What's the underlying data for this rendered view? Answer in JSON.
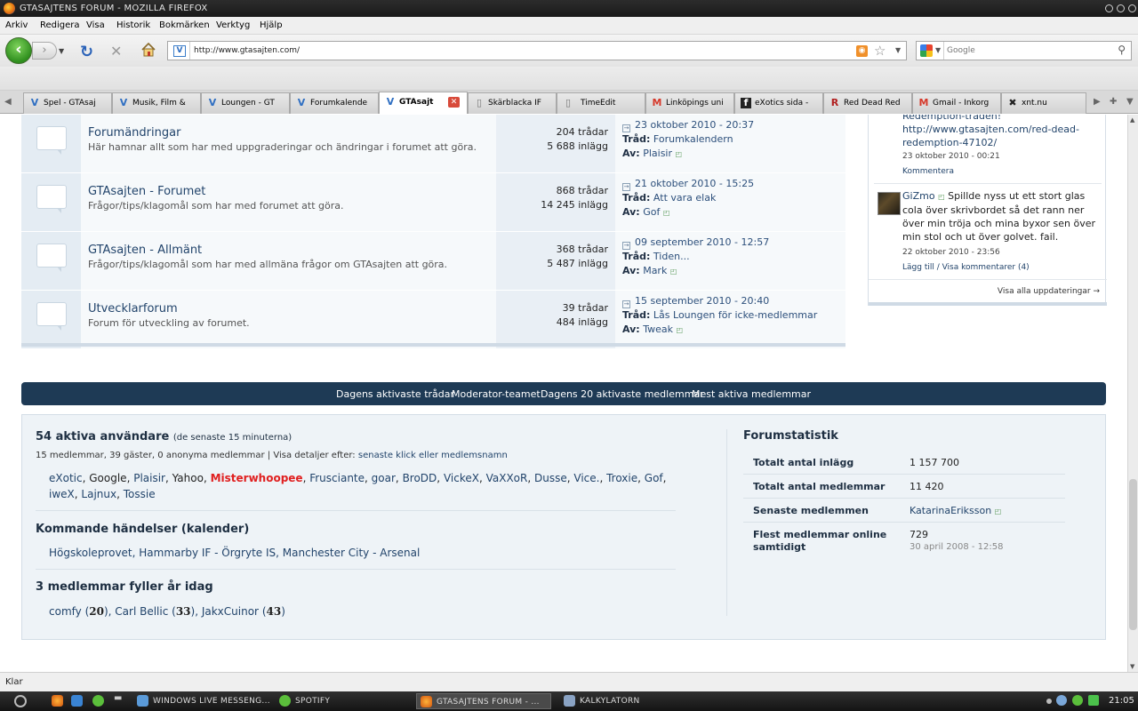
{
  "window": {
    "title": "GTASAJTENS FORUM - MOZILLA FIREFOX"
  },
  "menu": {
    "items": [
      "Arkiv",
      "Redigera",
      "Visa",
      "Historik",
      "Bokmärken",
      "Verktyg",
      "Hjälp"
    ]
  },
  "nav": {
    "url": "http://www.gtasajten.com/",
    "search_placeholder": "Google"
  },
  "tabs": [
    {
      "label": "Spel - GTAsaj",
      "icon": "gtasajten-icon"
    },
    {
      "label": "Musik, Film &",
      "icon": "gtasajten-icon"
    },
    {
      "label": "Loungen - GT",
      "icon": "gtasajten-icon"
    },
    {
      "label": "Forumkalende",
      "icon": "gtasajten-icon"
    },
    {
      "label": "GTAsajt",
      "icon": "gtasajten-icon",
      "active": true
    },
    {
      "label": "Skärblacka IF",
      "icon": "page-icon"
    },
    {
      "label": "TimeEdit",
      "icon": "page-icon"
    },
    {
      "label": "Linköpings uni",
      "icon": "gmail-icon"
    },
    {
      "label": "eXotics sida -",
      "icon": "facebook-icon"
    },
    {
      "label": "Red Dead Red",
      "icon": "rdr-icon"
    },
    {
      "label": "Gmail - Inkorg",
      "icon": "gmail-icon"
    },
    {
      "label": "xnt.nu",
      "icon": "xnt-icon"
    }
  ],
  "forums": [
    {
      "title": "Forumändringar",
      "description": "Här hamnar allt som har med uppgraderingar och ändringar i forumet att göra.",
      "threads": "204 trådar",
      "posts": "5 688 inlägg",
      "last_date": "23 oktober 2010 - 20:37",
      "last_thread": "Forumkalendern",
      "last_by": "Plaisir"
    },
    {
      "title": "GTAsajten - Forumet",
      "description": "Frågor/tips/klagomål som har med forumet att göra.",
      "threads": "868 trådar",
      "posts": "14 245 inlägg",
      "last_date": "21 oktober 2010 - 15:25",
      "last_thread": "Att vara elak",
      "last_by": "Gof"
    },
    {
      "title": "GTAsajten - Allmänt",
      "description": "Frågor/tips/klagomål som har med allmäna frågor om GTAsajten att göra.",
      "threads": "368 trådar",
      "posts": "5 487 inlägg",
      "last_date": "09 september 2010 - 12:57",
      "last_thread": "Tiden...",
      "last_by": "Mark"
    },
    {
      "title": "Utvecklarforum",
      "description": "Forum för utveckling av forumet.",
      "threads": "39 trådar",
      "posts": "484 inlägg",
      "last_date": "15 september 2010 - 20:40",
      "last_thread": "Lås Loungen för icke-medlemmar",
      "last_by": "Tweak"
    }
  ],
  "labels": {
    "thread": "Tråd:",
    "by": "Av:"
  },
  "sidebar": {
    "fragment_line1": "Redemption-tråden!",
    "fragment_link": "http://www.gtasajten.com/red-dead-redemption-47102/",
    "fragment_date": "23 oktober 2010 - 00:21",
    "fragment_action": "Kommentera",
    "status_user": "GiZmo",
    "status_text": "Spillde nyss ut ett stort glas cola över skrivbordet så det rann ner över min tröja och mina byxor sen över min stol och ut över golvet. fail.",
    "status_date": "22 oktober 2010 - 23:56",
    "status_action": "Lägg till / Visa kommentarer (4)",
    "view_all": "Visa alla uppdateringar →"
  },
  "footer_nav": [
    "Dagens aktivaste trådar",
    "Moderator-teamet",
    "Dagens 20 aktivaste medlemmar",
    "Mest aktiva medlemmar"
  ],
  "active_users": {
    "title": "54 aktiva användare",
    "title_note": "(de senaste 15 minuterna)",
    "summary": "15 medlemmar, 39 gäster, 0 anonyma medlemmar | Visa detaljer efter:",
    "sort_link": "senaste klick eller medlemsnamn",
    "users_line1": [
      "eXotic",
      "Google",
      "Plaisir",
      "Yahoo",
      "Misterwhoopee",
      "Frusciante",
      "goar",
      "BroDD",
      "VickeX",
      "VaXXoR",
      "Dusse",
      "Vice.",
      "Troxie",
      "Gof"
    ],
    "users_line2": [
      "iweX",
      "Lajnux",
      "Tossie"
    ],
    "highlight_user": "Misterwhoopee",
    "plain_users": [
      "Google",
      "Yahoo"
    ]
  },
  "events": {
    "title": "Kommande händelser (kalender)",
    "items": [
      "Högskoleprovet",
      "Hammarby IF - Örgryte IS",
      "Manchester City - Arsenal"
    ]
  },
  "birthdays": {
    "title": "3 medlemmar fyller år idag",
    "items": [
      {
        "name": "comfy",
        "age": "20"
      },
      {
        "name": "Carl Bellic",
        "age": "33"
      },
      {
        "name": "JakxCuinor",
        "age": "43"
      }
    ]
  },
  "forum_stats": {
    "title": "Forumstatistik",
    "rows": [
      {
        "label": "Totalt antal inlägg",
        "value": "1 157 700"
      },
      {
        "label": "Totalt antal medlemmar",
        "value": "11 420"
      },
      {
        "label": "Senaste medlemmen",
        "value": "KatarinaEriksson"
      },
      {
        "label": "Flest medlemmar online samtidigt",
        "value": "729",
        "sub": "30 april 2008 - 12:58"
      }
    ]
  },
  "status_bar": {
    "text": "Klar"
  },
  "taskbar": {
    "tasks": [
      "WINDOWS LIVE MESSENG...",
      "SPOTIFY",
      "GTASAJTENS FORUM - ...",
      "KALKYLATORN"
    ],
    "clock": "21:05"
  },
  "colors": {
    "link": "#22446b",
    "navy_bar": "#1e3a55",
    "highlight_red": "#e02020",
    "row_tint": "#e4ecf3"
  }
}
